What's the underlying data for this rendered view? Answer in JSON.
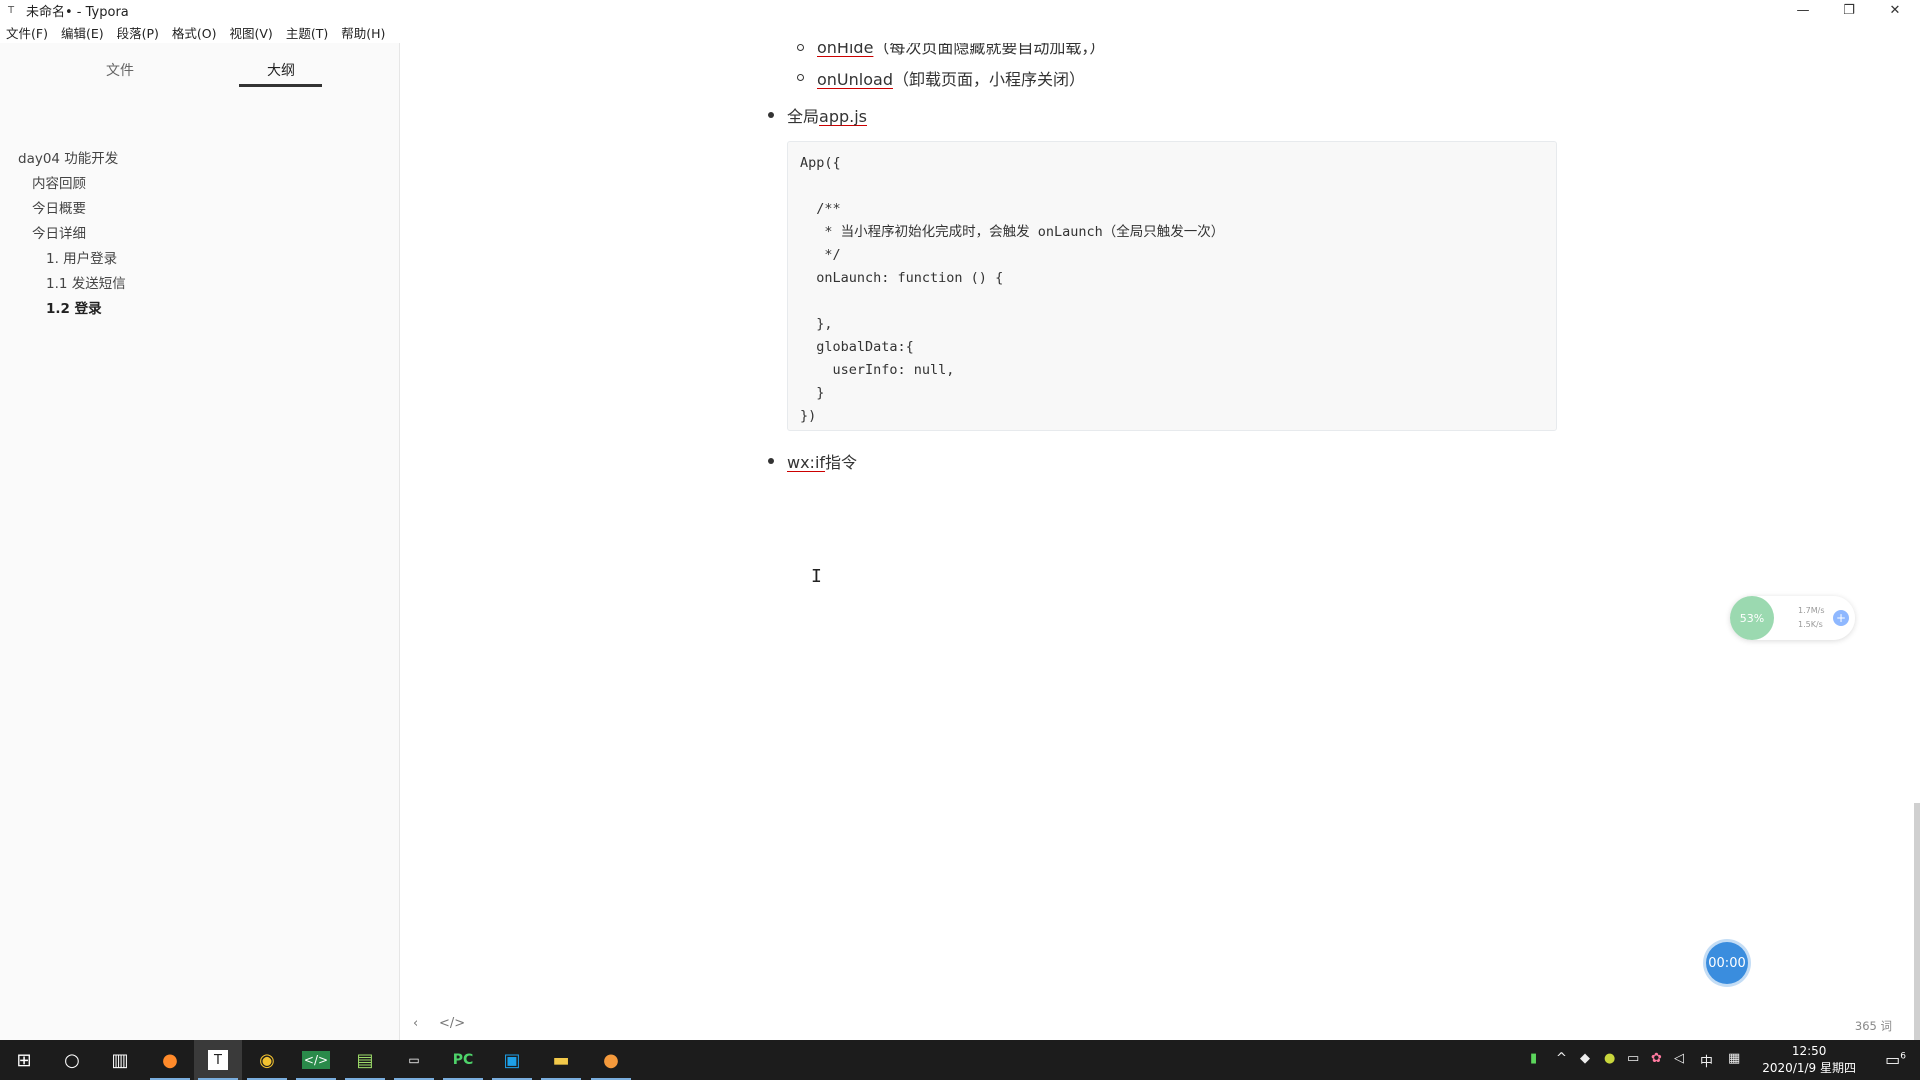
{
  "window": {
    "title": "未命名• - Typora",
    "app_icon": "T"
  },
  "menus": [
    "文件(F)",
    "编辑(E)",
    "段落(P)",
    "格式(O)",
    "视图(V)",
    "主题(T)",
    "帮助(H)"
  ],
  "sidebar": {
    "tabs": [
      {
        "label": "文件"
      },
      {
        "label": "大纲"
      }
    ],
    "outline": [
      {
        "label": "day04 功能开发"
      },
      {
        "label": "内容回顾"
      },
      {
        "label": "今日概要"
      },
      {
        "label": "今日详细"
      },
      {
        "label": "1. 用户登录"
      },
      {
        "label": "1.1 发送短信"
      },
      {
        "label": "1.2 登录"
      }
    ]
  },
  "editor": {
    "sub_items": [
      {
        "link": "onHide",
        "text": "（每次页面隐藏就要自动加载，）"
      },
      {
        "link": "onUnload",
        "text": "（卸载页面，小程序关闭）"
      }
    ],
    "item1": {
      "prefix": "全局",
      "link": "app.js"
    },
    "code": "App({\n\n  /**\n   * 当小程序初始化完成时，会触发 onLaunch（全局只触发一次）\n   */\n  onLaunch: function () {\n\n  },\n  globalData:{\n    userInfo: null,\n  }\n})",
    "item2": {
      "link": "wx:if",
      "suffix": "指令"
    }
  },
  "status": {
    "word_count": "365 词"
  },
  "net_widget": {
    "percent": "53%",
    "up": "1.7M/s",
    "down": "1.5K/s"
  },
  "timer": "00:00",
  "taskbar": {
    "clock_time": "12:50",
    "clock_date": "2020/1/9 星期四",
    "ime": "中",
    "notif_count": "6"
  }
}
